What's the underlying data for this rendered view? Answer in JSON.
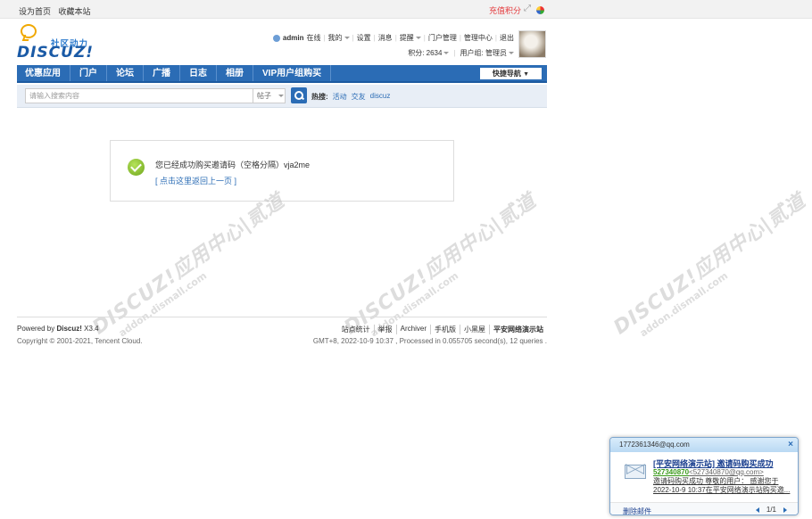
{
  "topbar": {
    "set_home": "设为首页",
    "bookmark": "收藏本站",
    "recharge": "充值积分"
  },
  "logo": {
    "tagline": "社区动力",
    "wordmark": "DISCUZ!"
  },
  "user": {
    "name": "admin",
    "status": "在线",
    "my": "我的",
    "settings": "设置",
    "messages": "消息",
    "reminders": "提醒",
    "portal_manage": "门户管理",
    "admin_center": "管理中心",
    "logout": "退出",
    "credits": "积分: 2634",
    "group": "用户组: 管理员"
  },
  "nav": {
    "items": [
      "优惠应用",
      "门户",
      "论坛",
      "广播",
      "日志",
      "相册",
      "VIP用户组购买"
    ],
    "quick_nav": "快捷导航"
  },
  "search": {
    "placeholder": "请输入搜索内容",
    "type": "帖子",
    "hot_label": "热搜:",
    "hot_terms": [
      "活动",
      "交友",
      "discuz"
    ]
  },
  "message": {
    "text": "您已经成功购买邀请码（空格分隔）vja2me",
    "back_link": "[ 点击这里返回上一页 ]"
  },
  "watermark": {
    "brand": "DISCUZ!应用中心",
    "site": "addon.dismall.com",
    "author": "贰道"
  },
  "footer": {
    "powered_prefix": "Powered by",
    "powered_brand": "Discuz!",
    "version": "X3.4",
    "copyright": "Copyright © 2001-2021, Tencent Cloud.",
    "links": [
      "站点统计",
      "举报",
      "Archiver",
      "手机版",
      "小黑屋"
    ],
    "site_name": "平安网络演示站",
    "info": "GMT+8, 2022-10-9 10:37 , Processed in 0.055705 second(s), 12 queries ."
  },
  "mail_popup": {
    "account": "1772361346@qq.com",
    "subject": "[平安网络演示站] 邀请码购买成功",
    "sender_id": "527340870",
    "sender_addr": "<527340870@qq.com>",
    "preview_line1": "邀请码购买成功  尊敬的用户：  感谢您于",
    "preview_line2": "2022-10-9 10:37在平安网络演示站购买邀...",
    "delete": "删除邮件",
    "pager": "1/1"
  }
}
